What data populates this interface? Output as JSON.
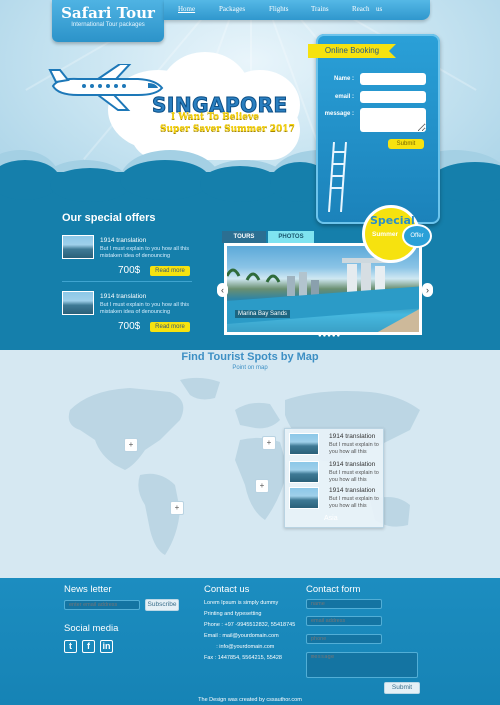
{
  "logo": {
    "title": "Safari Tour",
    "subtitle": "International Tour packages"
  },
  "nav": [
    "Home",
    "Packages",
    "Flights",
    "Trains",
    "Reach",
    "us"
  ],
  "hero": {
    "title": "SINGAPORE",
    "line1": "I Want To Believe",
    "line2": "Super Saver Summer 2017"
  },
  "booking": {
    "heading": "Online Booking",
    "name_label": "Name :",
    "email_label": "email :",
    "message_label": "message :",
    "submit": "Submit"
  },
  "offers": {
    "title": "Our special offers",
    "items": [
      {
        "name": "1914 translation",
        "desc": "But I must explain to you how all this mistaken idea of denouncing",
        "price": "700$",
        "button": "Read more"
      },
      {
        "name": "1914 translation",
        "desc": "But I must explain to you how all this mistaken idea of denouncing",
        "price": "700$",
        "button": "Read more"
      }
    ]
  },
  "tabs": [
    "TOURS",
    "PHOTOS"
  ],
  "slider": {
    "caption": "Marina Bay Sands",
    "prev": "‹",
    "next": "›",
    "dots": "●●●●●"
  },
  "special": {
    "title": "Special",
    "sub": "Summer",
    "badge": "Offer"
  },
  "map": {
    "title": "Find Tourist Spots by Map",
    "subtitle": "Point on map",
    "pin_symbol": "+",
    "popup_items": [
      {
        "name": "1914 translation",
        "desc": "But I must explain to you how all this"
      },
      {
        "name": "1914 translation",
        "desc": "But I must explain to you how all this"
      },
      {
        "name": "1914 translation",
        "desc": "But I must explain to you how all this"
      }
    ],
    "popup_footer": "Asia"
  },
  "footer": {
    "newsletter": {
      "heading": "News letter",
      "placeholder": "enter email address",
      "button": "Subscribe"
    },
    "social": {
      "heading": "Social media",
      "icons": [
        "twitter-icon",
        "facebook-icon",
        "linkedin-icon"
      ]
    },
    "contact": {
      "heading": "Contact us",
      "lines": [
        "Lorem Ipsum is simply dummy",
        "Printing and typesetting",
        "Phone : +97 -9945512832, 55418745",
        "Email : mail@yourdomain.com",
        "        : info@yourdomain.com",
        "Fax : 1447854, 5564215, 55428"
      ]
    },
    "form": {
      "heading": "Contact form",
      "name": "name",
      "email": "email address",
      "phone": "phone",
      "message": "message",
      "submit": "Submit"
    },
    "credits": "The Design was created by cssauthor.com"
  },
  "colors": {
    "primary": "#2aa0d8",
    "accent": "#f6e20f",
    "dark": "#157fab"
  }
}
